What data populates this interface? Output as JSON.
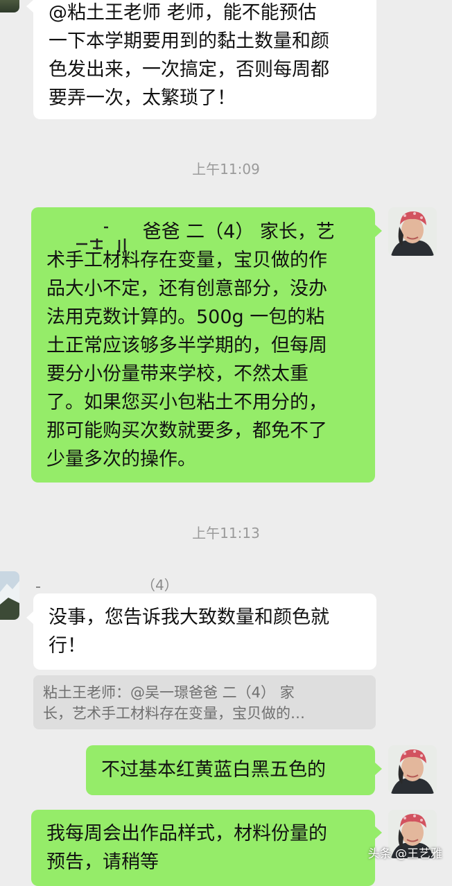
{
  "messages": {
    "m1": {
      "lines": [
        "@粘土王老师  老师，能不能预估",
        "一下本学期要用到的黏土数量和颜",
        "色发出来，一次搞定，否则每周都",
        "要弄一次，太繁琐了！"
      ]
    },
    "m2": {
      "lines": [
        "爸爸 二（4） 家长，艺",
        "术手工材料存在变量，宝贝做的作",
        "品大小不定，还有创意部分，没办",
        "法用克数计算的。500g 一包的粘",
        "土正常应该够多半学期的，但每周",
        "要分小份量带来学校，不然太重",
        "了。如果您买小包粘土不用分的，",
        "那可能购买次数就要多，都免不了",
        "少量多次的操作。"
      ]
    },
    "m3": {
      "sender": "（4）",
      "lines": [
        "没事，您告诉我大致数量和颜色就",
        "行！"
      ]
    },
    "quote": {
      "lines": [
        "粘土王老师：@吴一璟爸爸 二（4） 家",
        "长，艺术手工材料存在变量，宝贝做的…"
      ]
    },
    "m4": {
      "lines": [
        "不过基本红黄蓝白黑五色的"
      ]
    },
    "m5": {
      "lines": [
        "我每周会出作品样式，材料份量的",
        "预告，请稍等"
      ]
    }
  },
  "timestamps": {
    "t1": "上午11:09",
    "t2": "上午11:13"
  },
  "watermark": "头条 @王艺雅",
  "colors": {
    "background": "#ededed",
    "bubble_self": "#95ec69",
    "bubble_other": "#ffffff",
    "timestamp": "#9a9a9a",
    "quote_bg": "#dedede"
  }
}
